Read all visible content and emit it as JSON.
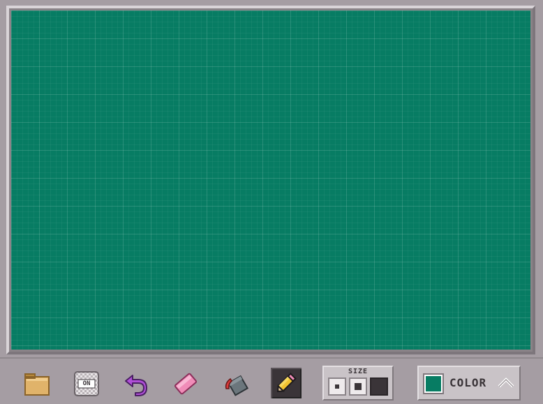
{
  "canvas": {
    "background_color": "#077c63",
    "grid": true
  },
  "toolbar": {
    "tools": [
      {
        "name": "folder-icon"
      },
      {
        "name": "grid-toggle-icon",
        "label": "ON"
      },
      {
        "name": "undo-icon"
      },
      {
        "name": "eraser-icon"
      },
      {
        "name": "fill-bucket-icon"
      },
      {
        "name": "pencil-icon",
        "selected": true
      }
    ],
    "size": {
      "label": "SIZE",
      "options": [
        "small",
        "medium",
        "large"
      ],
      "selected": "large"
    },
    "color": {
      "label": "COLOR",
      "current": "#077c63"
    }
  },
  "colors": {
    "frame": "#a59da3",
    "panel": "#c9c3c7",
    "dark": "#3a3438"
  }
}
